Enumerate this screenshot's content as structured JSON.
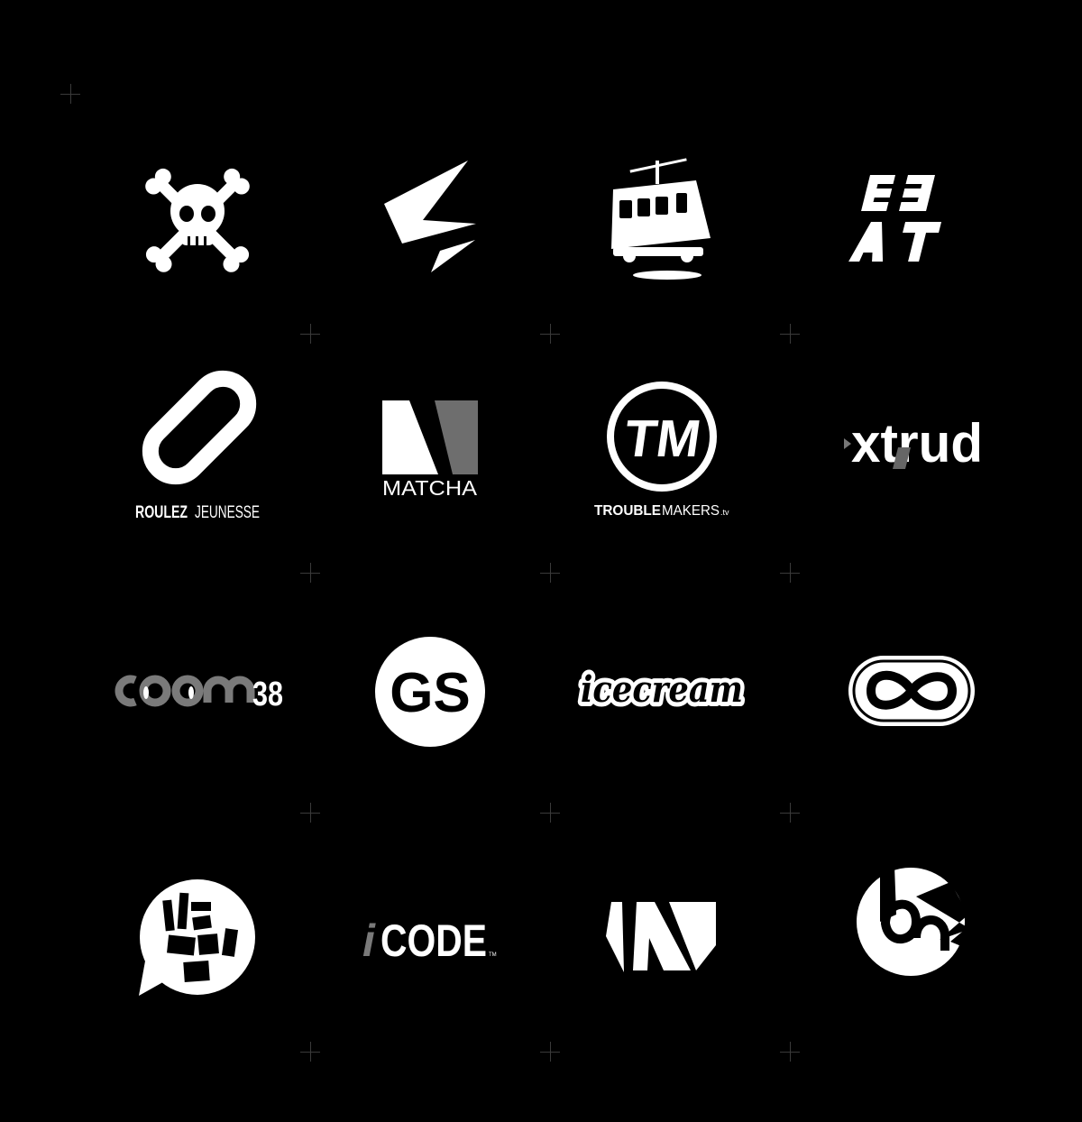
{
  "logos": [
    {
      "name": "skull-crossbones",
      "text": ""
    },
    {
      "name": "lightning-arrow",
      "text": ""
    },
    {
      "name": "tram",
      "text": ""
    },
    {
      "name": "beat",
      "text": ""
    },
    {
      "name": "roulez-jeunesse",
      "text_bold": "ROULEZ",
      "text_light": "JEUNESSE"
    },
    {
      "name": "matcha",
      "text": "MATCHA"
    },
    {
      "name": "troublemakers",
      "monogram": "TM",
      "text_bold": "TROUBLE",
      "text_light": "MAKERS",
      "suffix": ".tv"
    },
    {
      "name": "xtrud",
      "text": "xtrud"
    },
    {
      "name": "room38",
      "number": "38"
    },
    {
      "name": "gs",
      "text": "GS"
    },
    {
      "name": "icecream",
      "text": "icecream"
    },
    {
      "name": "infinity-loop",
      "text": ""
    },
    {
      "name": "ice-bean",
      "text": ""
    },
    {
      "name": "icode",
      "prefix": "i",
      "text": "CODE",
      "tm": "TM"
    },
    {
      "name": "w-mark",
      "text": ""
    },
    {
      "name": "bm-circle",
      "text": ""
    }
  ],
  "colors": {
    "background": "#000000",
    "foreground": "#ffffff",
    "gray": "#7a7a7a",
    "crosshair": "#3a3a3a"
  }
}
